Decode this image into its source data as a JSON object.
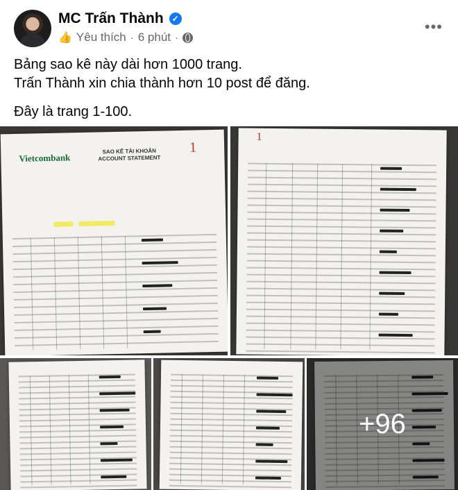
{
  "post": {
    "author": "MC Trấn Thành",
    "reaction_label": "Yêu thích",
    "separator": "·",
    "time": "6 phút",
    "more_label": "•••",
    "text_line1": "Bảng sao kê này dài hơn 1000 trang.",
    "text_line2": "Trấn Thành xin chia thành hơn 10 post để đăng.",
    "text_line3": "Đây là trang 1-100."
  },
  "photos": {
    "bank_name": "Vietcombank",
    "doc_title_line1": "SAO KÊ TÀI KHOẢN",
    "doc_title_line2": "ACCOUNT STATEMENT",
    "page_mark_1": "1",
    "page_mark_2": "1",
    "more_count": "+96"
  },
  "colors": {
    "verified": "#1877f2",
    "meta_text": "#65676b",
    "bank_green": "#1a6b3a",
    "page_mark_red": "#c6322c"
  },
  "icons": {
    "verified": "check-badge",
    "audience": "globe",
    "reaction": "thumbs-up"
  }
}
